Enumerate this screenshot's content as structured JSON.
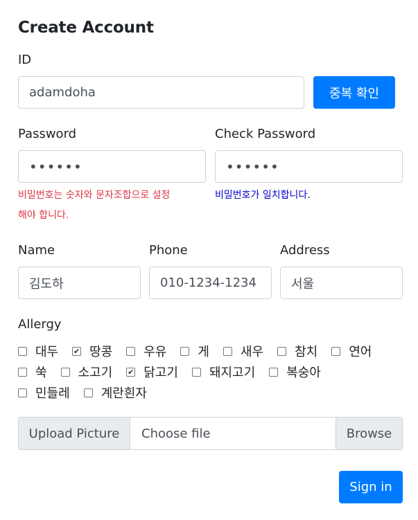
{
  "form": {
    "title": "Create Account",
    "id": {
      "label": "ID",
      "value": "adamdoha",
      "check_button": "중복 확인"
    },
    "password": {
      "label": "Password",
      "value": "••••••",
      "error": "비밀번호는 숫자와 문자조합으로 설정",
      "error_line2": "해야 합니다."
    },
    "check_password": {
      "label": "Check Password",
      "value": "••••••",
      "message": "비밀번호가 일치합니다."
    },
    "name": {
      "label": "Name",
      "value": "김도하"
    },
    "phone": {
      "label": "Phone",
      "value": "010-1234-1234"
    },
    "address": {
      "label": "Address",
      "value": "서울"
    },
    "allergy": {
      "label": "Allergy",
      "rows": [
        [
          {
            "label": "대두",
            "checked": false
          },
          {
            "label": "땅콩",
            "checked": true
          },
          {
            "label": "우유",
            "checked": false
          },
          {
            "label": "게",
            "checked": false
          },
          {
            "label": "새우",
            "checked": false
          },
          {
            "label": "참치",
            "checked": false
          },
          {
            "label": "연어",
            "checked": false
          }
        ],
        [
          {
            "label": "쑥",
            "checked": false
          },
          {
            "label": "소고기",
            "checked": false
          },
          {
            "label": "닭고기",
            "checked": true
          },
          {
            "label": "돼지고기",
            "checked": false
          },
          {
            "label": "복숭아",
            "checked": false
          }
        ],
        [
          {
            "label": "민들레",
            "checked": false
          },
          {
            "label": "계란흰자",
            "checked": false
          }
        ]
      ]
    },
    "upload": {
      "prefix": "Upload Picture",
      "placeholder": "Choose file",
      "browse": "Browse"
    },
    "submit": "Sign in"
  },
  "colors": {
    "primary": "#007bff",
    "error": "#dc3545",
    "ok": "#0000cc"
  }
}
